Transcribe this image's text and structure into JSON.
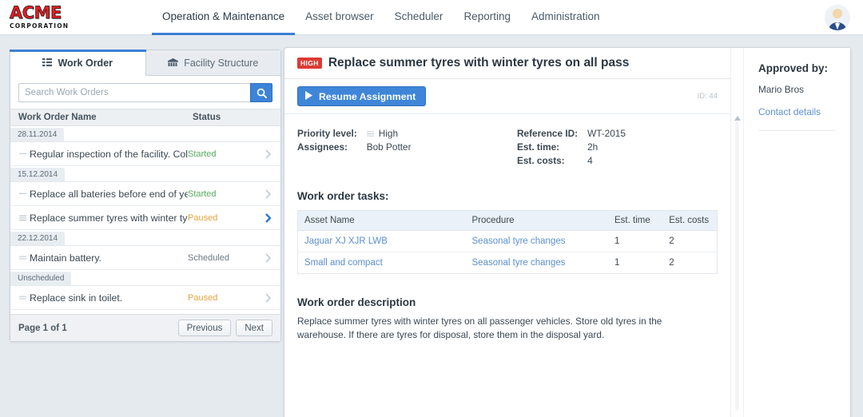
{
  "brand": {
    "name": "ACME",
    "sub": "CORPORATION",
    "color": "#e81c23"
  },
  "nav": {
    "items": [
      {
        "label": "Operation & Maintenance",
        "active": true
      },
      {
        "label": "Asset browser",
        "active": false
      },
      {
        "label": "Scheduler",
        "active": false
      },
      {
        "label": "Reporting",
        "active": false
      },
      {
        "label": "Administration",
        "active": false
      }
    ],
    "accent": "#3c7fd4"
  },
  "avatar": {
    "icon": "user-avatar-icon"
  },
  "left_panel": {
    "tabs": [
      {
        "label": "Work Order",
        "icon": "list-grid-icon",
        "active": true
      },
      {
        "label": "Facility Structure",
        "icon": "building-icon",
        "active": false
      }
    ],
    "search": {
      "placeholder": "Search Work Orders",
      "value": "",
      "button_icon": "search-icon"
    },
    "columns": {
      "name": "Work Order Name",
      "status": "Status"
    },
    "groups": [
      {
        "label": "28.11.2014",
        "rows": [
          {
            "name": "Regular inspection of the facility. Collect all i",
            "status": "Started",
            "status_kind": "started",
            "selected": false
          }
        ]
      },
      {
        "label": "15.12.2014",
        "rows": [
          {
            "name": "Replace all bateries before end of year.",
            "status": "Started",
            "status_kind": "started",
            "selected": false
          },
          {
            "name": "Replace summer tyres with winter tyres on all",
            "status": "Paused",
            "status_kind": "paused",
            "selected": true
          }
        ]
      },
      {
        "label": "22.12.2014",
        "rows": [
          {
            "name": "Maintain battery.",
            "status": "Scheduled",
            "status_kind": "scheduled",
            "selected": false
          }
        ]
      },
      {
        "label": "Unscheduled",
        "rows": [
          {
            "name": "Replace sink in toilet.",
            "status": "Paused",
            "status_kind": "paused",
            "selected": false
          }
        ]
      }
    ],
    "pager": {
      "text": "Page 1 of 1",
      "previous": "Previous",
      "next": "Next"
    }
  },
  "detail": {
    "priority_badge": "HIGH",
    "priority_badge_color": "#dd3a33",
    "title": "Replace summer tyres with winter tyres on all pass",
    "resume_button": "Resume Assignment",
    "id_label": "ID: 44",
    "meta_left": [
      {
        "key": "Priority level:",
        "value": "High",
        "has_icon": true
      },
      {
        "key": "Assignees:",
        "value": "Bob Potter",
        "has_icon": false
      }
    ],
    "meta_right": [
      {
        "key": "Reference ID:",
        "value": "WT-2015"
      },
      {
        "key": "Est. time:",
        "value": "2h"
      },
      {
        "key": "Est. costs:",
        "value": "4"
      }
    ],
    "tasks_title": "Work order tasks:",
    "tasks_columns": [
      "Asset Name",
      "Procedure",
      "Est. time",
      "Est. costs"
    ],
    "tasks_rows": [
      {
        "asset": "Jaguar XJ XJR LWB",
        "procedure": "Seasonal tyre changes",
        "time": "1",
        "costs": "2"
      },
      {
        "asset": "Small and compact",
        "procedure": "Seasonal tyre changes",
        "time": "1",
        "costs": "2"
      }
    ],
    "description_title": "Work order description",
    "description_body": "Replace summer tyres with winter tyres on all passenger vehicles. Store old tyres in the warehouse. If there are tyres for disposal, store them in the disposal yard."
  },
  "approved": {
    "title": "Approved by:",
    "name": "Mario Bros",
    "link": "Contact details"
  }
}
